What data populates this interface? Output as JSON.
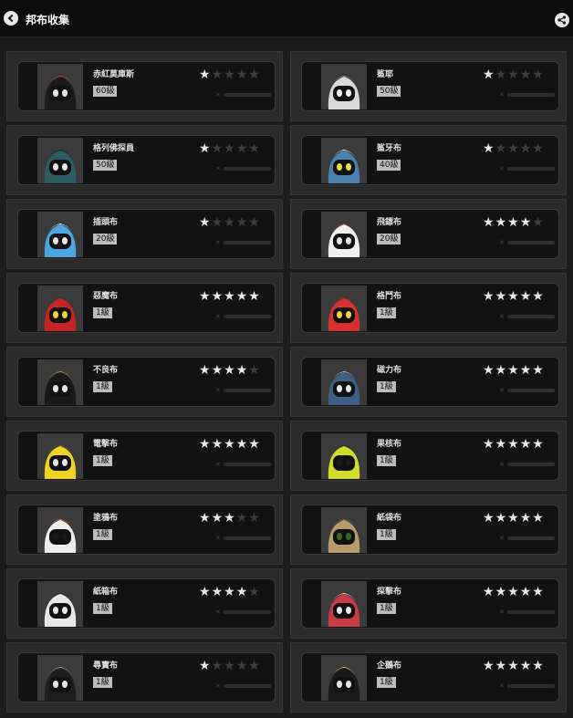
{
  "header": {
    "title": "邦布收集"
  },
  "bangboos": [
    {
      "name": "赤紅莫庫斯",
      "level": "60級",
      "stars": 1,
      "colors": {
        "body": "#1b1b1b",
        "accent": "#d8552a",
        "eye": "#e4e4e4"
      }
    },
    {
      "name": "鯊耶",
      "level": "50級",
      "stars": 1,
      "colors": {
        "body": "#d9d9d9",
        "accent": "#8a8a8a",
        "eye": "#f5f5f5"
      }
    },
    {
      "name": "格列佛探員",
      "level": "50級",
      "stars": 1,
      "colors": {
        "body": "#2d5c62",
        "accent": "#111111",
        "eye": "#e6e6e6"
      }
    },
    {
      "name": "鯊牙布",
      "level": "40級",
      "stars": 1,
      "colors": {
        "body": "#4a7fae",
        "accent": "#f0f0f0",
        "eye": "#e9e14a"
      }
    },
    {
      "name": "插頭布",
      "level": "20級",
      "stars": 1,
      "colors": {
        "body": "#4da6e0",
        "accent": "#ffffff",
        "eye": "#e6e6e6"
      }
    },
    {
      "name": "飛鏢布",
      "level": "20級",
      "stars": 4,
      "colors": {
        "body": "#efefef",
        "accent": "#c42a2a",
        "eye": "#e6e6e6"
      }
    },
    {
      "name": "惡魔布",
      "level": "1級",
      "stars": 5,
      "colors": {
        "body": "#c42424",
        "accent": "#3a2a4a",
        "eye": "#f2d04a"
      }
    },
    {
      "name": "格鬥布",
      "level": "1級",
      "stars": 5,
      "colors": {
        "body": "#d63030",
        "accent": "#a51f1f",
        "eye": "#f2d04a"
      }
    },
    {
      "name": "不良布",
      "level": "1級",
      "stars": 4,
      "colors": {
        "body": "#1a1a1a",
        "accent": "#e7a93a",
        "eye": "#e6e6e6"
      }
    },
    {
      "name": "磁力布",
      "level": "1級",
      "stars": 5,
      "colors": {
        "body": "#3f5f86",
        "accent": "#cfcfcf",
        "eye": "#e6e6e6"
      }
    },
    {
      "name": "電擊布",
      "level": "1級",
      "stars": 5,
      "colors": {
        "body": "#efd51f",
        "accent": "#555555",
        "eye": "#e6e6e6"
      }
    },
    {
      "name": "果核布",
      "level": "1級",
      "stars": 5,
      "colors": {
        "body": "#d2dc2b",
        "accent": "#2b2b2b",
        "eye": "#1a1a1a"
      }
    },
    {
      "name": "塗鴉布",
      "level": "1級",
      "stars": 3,
      "colors": {
        "body": "#eeeeee",
        "accent": "#e8782a",
        "eye": "#1a1a1a"
      }
    },
    {
      "name": "紙袋布",
      "level": "1級",
      "stars": 5,
      "colors": {
        "body": "#b79a6a",
        "accent": "#8a6d43",
        "eye": "#3a6a2a"
      }
    },
    {
      "name": "紙箱布",
      "level": "1級",
      "stars": 4,
      "colors": {
        "body": "#e8e8e8",
        "accent": "#2a2a2a",
        "eye": "#e6e6e6"
      }
    },
    {
      "name": "探擊布",
      "level": "1級",
      "stars": 5,
      "colors": {
        "body": "#c83a46",
        "accent": "#ececec",
        "eye": "#e6e6e6"
      }
    },
    {
      "name": "尋寶布",
      "level": "1級",
      "stars": 1,
      "colors": {
        "body": "#1e1e1e",
        "accent": "#c8b88a",
        "eye": "#e6e6e6"
      }
    },
    {
      "name": "企鵝布",
      "level": "1級",
      "stars": 5,
      "colors": {
        "body": "#1a1a1a",
        "accent": "#f0d000",
        "eye": "#e6e6e6"
      }
    }
  ],
  "icons": {
    "back": "chevron-left-icon",
    "share": "share-icon",
    "star": "star-icon"
  }
}
